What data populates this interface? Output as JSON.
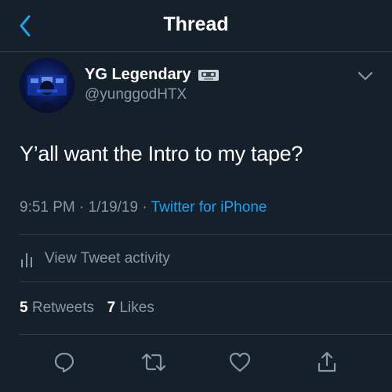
{
  "header": {
    "title": "Thread",
    "back_icon": "chevron-left-icon"
  },
  "tweet": {
    "author_name": "YG Legendary",
    "author_handle": "@yunggodHTX",
    "text": "Y’all want the Intro to my tape?",
    "time": "9:51 PM",
    "date": "1/19/19",
    "separator": "·",
    "source": "Twitter for iPhone",
    "activity_label": "View Tweet activity",
    "retweets_count": "5",
    "retweets_label": "Retweets",
    "likes_count": "7",
    "likes_label": "Likes"
  },
  "actions": [
    "reply-icon",
    "retweet-icon",
    "like-icon",
    "share-icon"
  ],
  "colors": {
    "background": "#15202b",
    "accent": "#1da1f2",
    "secondary_text": "#8899a6",
    "divider": "#2f3b47"
  }
}
